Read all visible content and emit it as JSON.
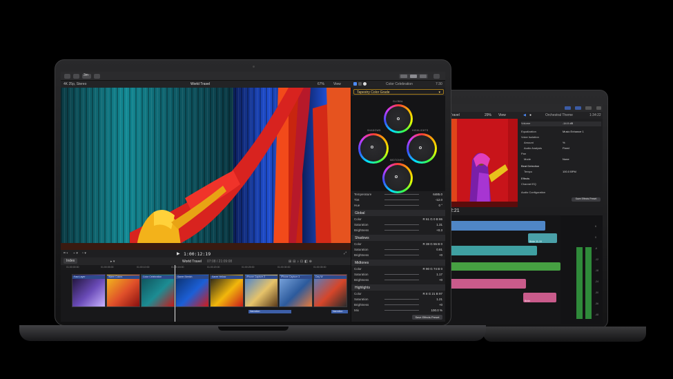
{
  "front": {
    "toolbar": {
      "badge": "3m"
    },
    "viewer_bar": {
      "library": "4K 25p, Stereo",
      "project": "World Travel",
      "zoom": "67%",
      "view": "View"
    },
    "transport": {
      "timecode": "1:00:12:19",
      "play_icon": "play-icon"
    },
    "inspector": {
      "title": "Color Celebration",
      "duration": "7:30",
      "effect_selector": "Tapestry Color Grade",
      "wheels": [
        "GLOBAL",
        "SHADOWS",
        "HIGHLIGHTS",
        "MIDTONES"
      ],
      "top_params": [
        {
          "label": "Temperature",
          "value": "6485.0"
        },
        {
          "label": "Tint",
          "value": "-12.0"
        },
        {
          "label": "Hue",
          "value": "0 °"
        }
      ],
      "sections": [
        {
          "name": "Global",
          "rows": [
            {
              "label": "Color",
              "value": "R 61  G 0  B 86"
            },
            {
              "label": "Saturation",
              "value": "1.31"
            },
            {
              "label": "Brightness",
              "value": "+0.3"
            }
          ]
        },
        {
          "name": "Shadows",
          "rows": [
            {
              "label": "Color",
              "value": "R 38  G 55  B 0"
            },
            {
              "label": "Saturation",
              "value": "0.81"
            },
            {
              "label": "Brightness",
              "value": "+0"
            }
          ]
        },
        {
          "name": "Midtones",
          "rows": [
            {
              "label": "Color",
              "value": "R 90  G 74  B 0"
            },
            {
              "label": "Saturation",
              "value": "1.17"
            },
            {
              "label": "Brightness",
              "value": "+0"
            }
          ]
        },
        {
          "name": "Highlights",
          "rows": [
            {
              "label": "Color",
              "value": "R 8  G 21  B 97"
            },
            {
              "label": "Saturation",
              "value": "1.21"
            },
            {
              "label": "Brightness",
              "value": "+0"
            },
            {
              "label": "Mix",
              "value": "100.0 %"
            }
          ]
        }
      ],
      "save_preset": "Save Effects Preset"
    },
    "timeline": {
      "index_tab": "Index",
      "project": "World Travel",
      "duration": "07:08 / 21:09:08",
      "ruler": [
        "01:00:00:00",
        "01:00:05:00",
        "01:00:10:00",
        "01:00:15:00",
        "01:00:20:00",
        "01:00:25:00",
        "01:00:30:00",
        "01:00:35:00"
      ],
      "clips": [
        {
          "title": "Fast Layer",
          "colors": [
            "#1b1030",
            "#6a4bb8",
            "#c9b4ff"
          ]
        },
        {
          "title": "Warm Colors",
          "colors": [
            "#f3c11c",
            "#e0502a",
            "#8a1010"
          ]
        },
        {
          "title": "Color Celebration",
          "colors": [
            "#0f4f57",
            "#1c8c93",
            "#c41b1b"
          ]
        },
        {
          "title": "Saree Stretch",
          "colors": [
            "#0b2f6a",
            "#1c5fd6",
            "#d11b1b"
          ]
        },
        {
          "title": "Saree Yellow",
          "colors": [
            "#1b1b1b",
            "#f2b70c",
            "#c81b1b"
          ]
        },
        {
          "title": "iPhone Capture 2",
          "colors": [
            "#3f7fd6",
            "#e6c36a",
            "#5a3a1a"
          ]
        },
        {
          "title": "iPhone Capture 3",
          "colors": [
            "#7fa9e0",
            "#2c5a9c",
            "#e87a3a"
          ]
        },
        {
          "title": "Day W",
          "colors": [
            "#4d82c9",
            "#d6462a",
            "#2b2b2b"
          ]
        }
      ],
      "narration": [
        "Narration",
        "Narration"
      ]
    }
  },
  "back": {
    "project": "Travel",
    "zoom": "29%",
    "view": "View",
    "title": "Orchestral Theme",
    "duration": "1:34:22",
    "timecode": "2:21",
    "params": [
      {
        "label": "Volume",
        "value": "-14.0  dB"
      },
      {
        "label": "Equalization",
        "value": "Music Enhance 1"
      },
      {
        "label": "Voice Isolation",
        "value": ""
      },
      {
        "label": "Amount",
        "value": "  %"
      },
      {
        "label": "Audio Analysis",
        "value": "Fixed"
      },
      {
        "label": "Pan",
        "value": ""
      },
      {
        "label": "Mode",
        "value": "None"
      },
      {
        "label": "Beat Detection",
        "value": ""
      },
      {
        "label": "Tempo",
        "value": "100.0  BPM"
      },
      {
        "label": "Effects",
        "value": ""
      },
      {
        "label": "Channel EQ",
        "value": ""
      },
      {
        "label": "Audio Configuration",
        "value": ""
      }
    ],
    "save_preset": "Save Effects Preset",
    "track_labels": [
      "Bride 11-10",
      "Bride"
    ],
    "meter_scale": [
      "6",
      "0",
      "-6",
      "-12",
      "-18",
      "-24",
      "-30",
      "-36",
      "-48"
    ]
  }
}
